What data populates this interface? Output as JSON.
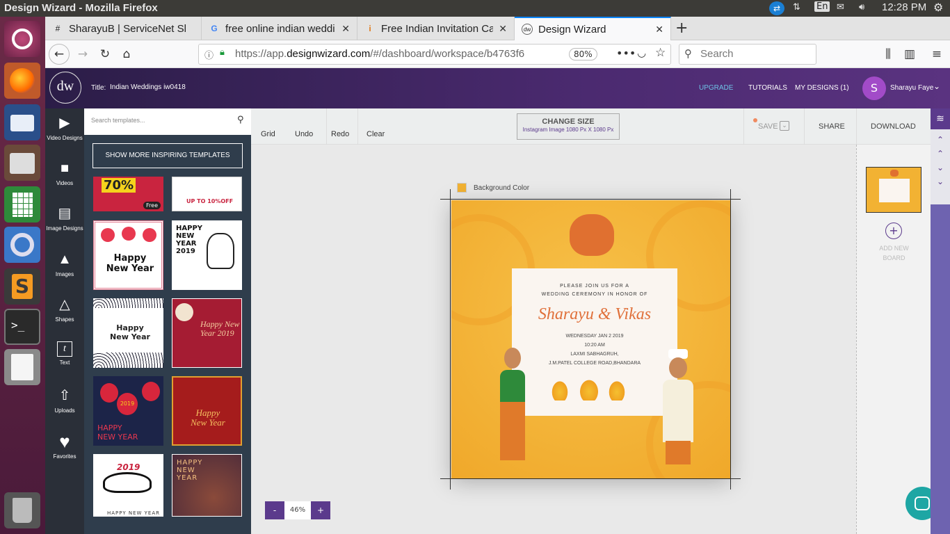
{
  "os_bar": {
    "title": "Design Wizard - Mozilla Firefox",
    "lang": "En",
    "time": "12:28 PM"
  },
  "launcher": {
    "apps": [
      "ubuntu-icon",
      "firefox-icon",
      "thunderbird-icon",
      "files-icon",
      "calc-icon",
      "chromium-icon",
      "sublime-icon",
      "terminal-icon",
      "text-editor-icon",
      "trash-icon"
    ]
  },
  "tabs": [
    {
      "label": "SharayuB | ServiceNet Sl",
      "icon": "#"
    },
    {
      "label": "free online indian weddi",
      "icon": "G"
    },
    {
      "label": "Free Indian Invitation Ca",
      "icon": "i"
    },
    {
      "label": "Design Wizard",
      "icon": "dw"
    }
  ],
  "nav": {
    "url_prefix": "https://app.",
    "url_domain": "designwizard.com",
    "url_rest": "/#/dashboard/workspace/b4763f6",
    "zoom": "80%",
    "search_placeholder": "Search"
  },
  "app_header": {
    "logo": "dw",
    "title_label": "Title:",
    "title_value": "Indian Weddings iw0418",
    "upgrade": "UPGRADE",
    "tutorials": "TUTORIALS",
    "my_designs": "MY DESIGNS (1)",
    "avatar_letter": "S",
    "user_name": "Sharayu Faye"
  },
  "left_nav": [
    {
      "label": "Video Designs",
      "icon": "video-design-icon",
      "glyph": "▶"
    },
    {
      "label": "Videos",
      "icon": "video-icon",
      "glyph": "■"
    },
    {
      "label": "Image Designs",
      "icon": "image-design-icon",
      "glyph": "▤"
    },
    {
      "label": "Images",
      "icon": "image-icon",
      "glyph": "▲"
    },
    {
      "label": "Shapes",
      "icon": "shapes-icon",
      "glyph": "△"
    },
    {
      "label": "Text",
      "icon": "text-icon",
      "glyph": "t"
    },
    {
      "label": "Uploads",
      "icon": "upload-icon",
      "glyph": "⇧"
    },
    {
      "label": "Favorites",
      "icon": "heart-icon",
      "glyph": "♥"
    }
  ],
  "templates": {
    "search_placeholder": "Search templates...",
    "show_more": "SHOW MORE INSPIRING TEMPLATES",
    "items": [
      {
        "text": "70%",
        "sub": "Free",
        "bg": "#c9243f"
      },
      {
        "text": "UP TO 10%OFF",
        "sub": "",
        "bg": "#ffffff"
      },
      {
        "text": "Happy New Year",
        "sub": "",
        "bg": "#ffffff"
      },
      {
        "text": "HAPPY NEW YEAR 2019",
        "sub": "",
        "bg": "#ffffff"
      },
      {
        "text": "Happy New Year",
        "sub": "",
        "bg": "#ffffff"
      },
      {
        "text": "Happy New Year 2019",
        "sub": "",
        "bg": "#a51c33"
      },
      {
        "text": "HAPPY NEW YEAR",
        "sub": "2019",
        "bg": "#1c2448"
      },
      {
        "text": "Happy New Year",
        "sub": "",
        "bg": "#a51c1c"
      },
      {
        "text": "2019",
        "sub": "HAPPY NEW YEAR",
        "bg": "#ffffff"
      },
      {
        "text": "HAPPY NEW YEAR",
        "sub": "",
        "bg": "#4a2a3a"
      }
    ]
  },
  "toolbar": {
    "grid": "Grid",
    "undo": "Undo",
    "redo": "Redo",
    "clear": "Clear",
    "change_size": "CHANGE SIZE",
    "size_sub": "Instagram Image 1080 Px X 1080 Px",
    "save": "SAVE",
    "share": "SHARE",
    "download": "DOWNLOAD"
  },
  "canvas": {
    "bg_color_label": "Background Color",
    "bg_color": "#f2b233",
    "invite_line1": "PLEASE JOIN US FOR A",
    "invite_line2": "WEDDING CEREMONY IN HONOR OF",
    "names": "Sharayu & Vikas",
    "date": "WEDNESDAY JAN 2 2019",
    "time": "10:20 AM",
    "venue1": "LAXMI SABHAGRUH,",
    "venue2": "J.M.PATEL COLLEGE ROAD,BHANDARA"
  },
  "zoom": {
    "minus": "-",
    "value": "46%",
    "plus": "+"
  },
  "boards": {
    "add_line1": "ADD NEW",
    "add_line2": "BOARD"
  },
  "colors": {
    "header_purple": "#4b2a70",
    "accent_blue": "#6ec3e6",
    "nav_dark": "#2a2f38",
    "panel_dark": "#2f3d4c",
    "zoom_purple": "#5b3a8c",
    "chat_teal": "#1ea6a4"
  }
}
